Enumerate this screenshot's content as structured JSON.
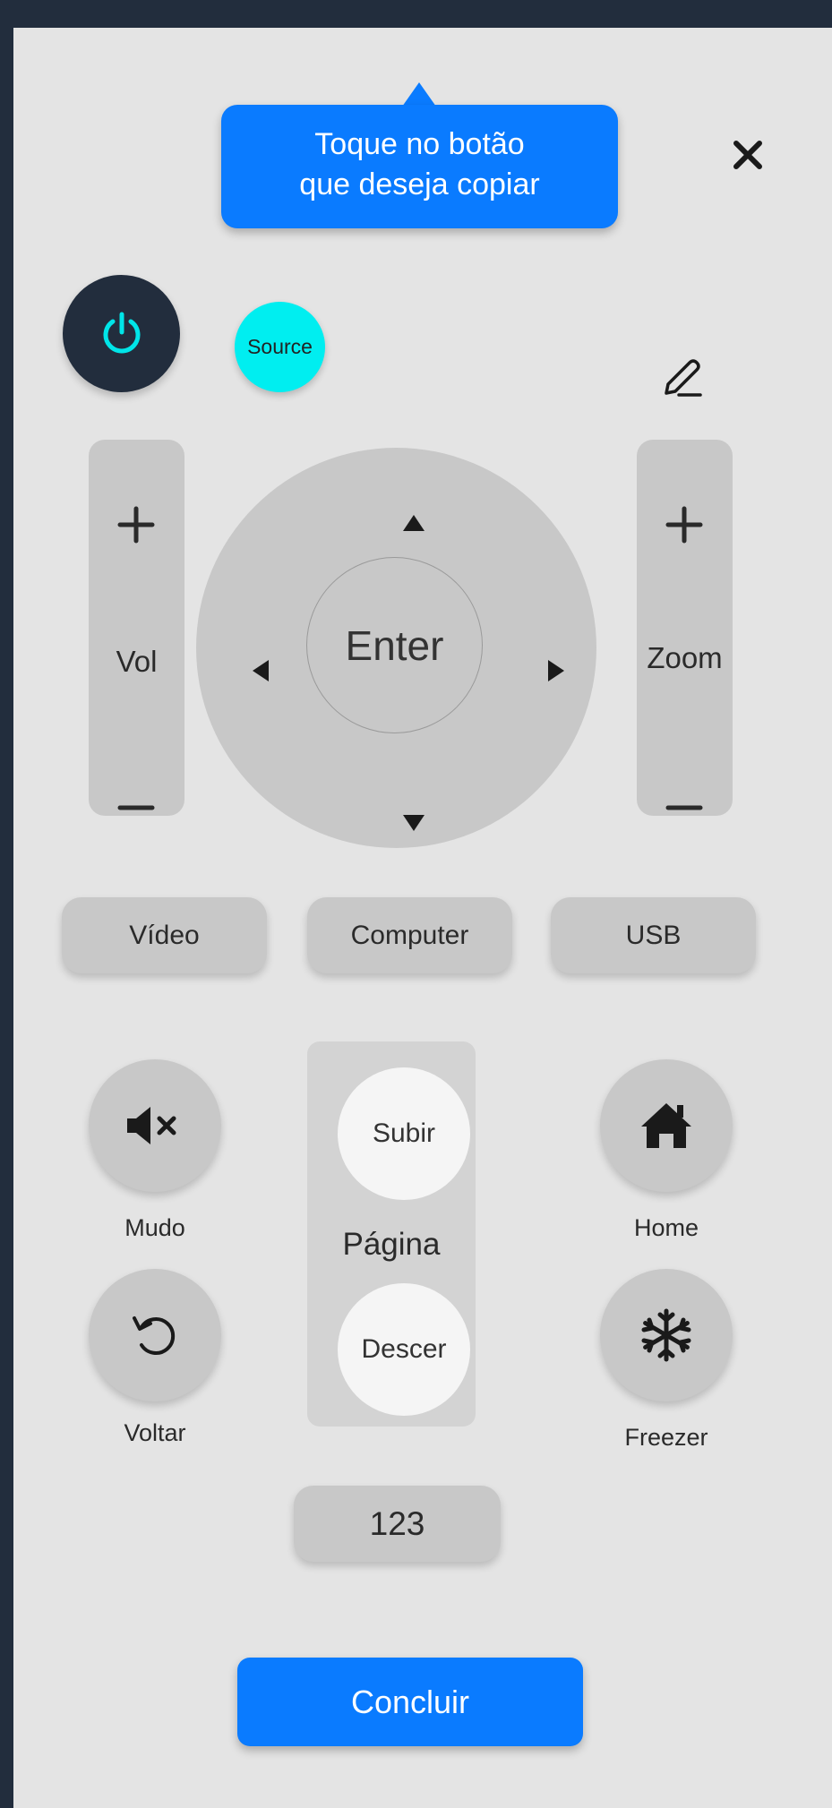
{
  "tooltip": {
    "line1": "Toque no botão",
    "line2": "que deseja copiar"
  },
  "header": {
    "close_icon": "close-icon"
  },
  "top_row": {
    "power_icon": "power-icon",
    "power_color": "#00e5e8",
    "source_label": "Source",
    "source_color": "#00eef0",
    "edit_icon": "pencil-icon"
  },
  "volume": {
    "label": "Vol",
    "plus": "+",
    "minus": "−"
  },
  "zoom": {
    "label": "Zoom",
    "plus": "+",
    "minus": "−"
  },
  "dpad": {
    "center_label": "Enter"
  },
  "inputs": [
    {
      "label": "Vídeo"
    },
    {
      "label": "Computer"
    },
    {
      "label": "USB"
    }
  ],
  "actions": {
    "mute": {
      "label": "Mudo",
      "icon": "mute-icon"
    },
    "back": {
      "label": "Voltar",
      "icon": "undo-icon"
    },
    "home": {
      "label": "Home",
      "icon": "home-icon"
    },
    "freeze": {
      "label": "Freezer",
      "icon": "snowflake-icon"
    }
  },
  "page": {
    "label": "Página",
    "up_label": "Subir",
    "down_label": "Descer"
  },
  "numpad_label": "123",
  "conclude_label": "Concluir",
  "colors": {
    "accent": "#0a7bff",
    "background": "#222d3d",
    "panel": "#e4e4e4",
    "button": "#c8c8c8"
  }
}
